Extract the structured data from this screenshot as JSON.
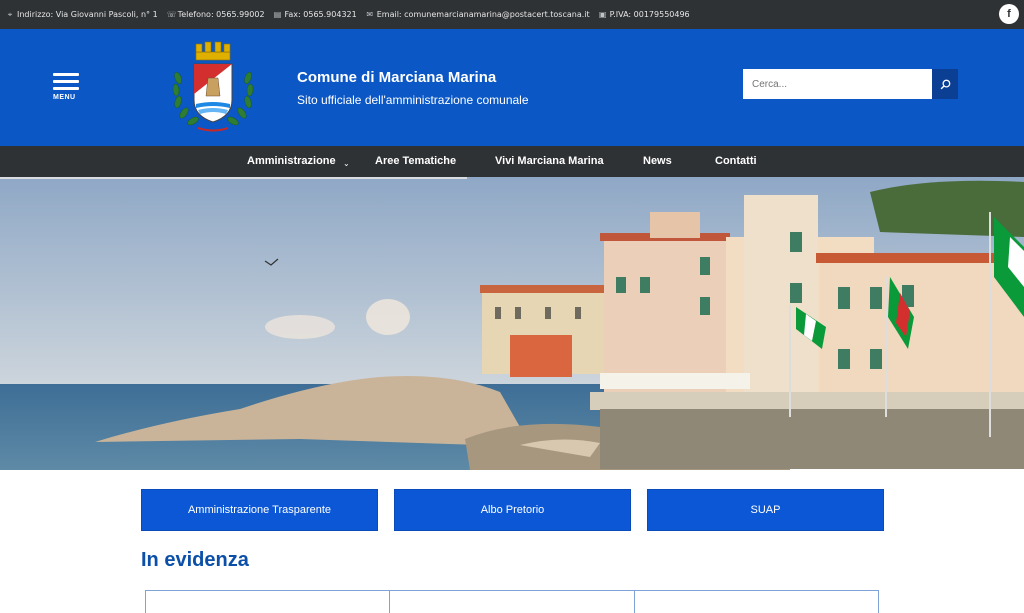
{
  "topbar": {
    "address": "Indirizzo: Via Giovanni Pascoli, n° 1",
    "phone": "Telefono: 0565.99002",
    "fax": "Fax: 0565.904321",
    "email": "Email: comunemarcianamarina@postacert.toscana.it",
    "vat": "P.IVA: 00179550496",
    "facebook": "f"
  },
  "header": {
    "menu_label": "MENU",
    "title": "Comune di Marciana Marina",
    "subtitle": "Sito ufficiale dell'amministrazione comunale",
    "search_placeholder": "Cerca..."
  },
  "nav": {
    "items": [
      {
        "label": "Amministrazione"
      },
      {
        "label": "Aree Tematiche"
      },
      {
        "label": "Vivi Marciana Marina"
      },
      {
        "label": "News"
      },
      {
        "label": "Contatti"
      }
    ],
    "dropdown_chevron": "⌄"
  },
  "quick_links": [
    {
      "label": "Amministrazione Trasparente"
    },
    {
      "label": "Albo Pretorio"
    },
    {
      "label": "SUAP"
    }
  ],
  "section": {
    "title": "In evidenza"
  },
  "colors": {
    "topbar_bg": "#2f3235",
    "header_blue": "#0b57c5",
    "button_blue": "#0b57d6",
    "section_title": "#0b4fa8"
  },
  "icons": [
    "location-icon",
    "phone-icon",
    "fax-icon",
    "email-icon",
    "vat-icon",
    "facebook-icon",
    "search-icon",
    "hamburger-icon",
    "crest-logo"
  ]
}
